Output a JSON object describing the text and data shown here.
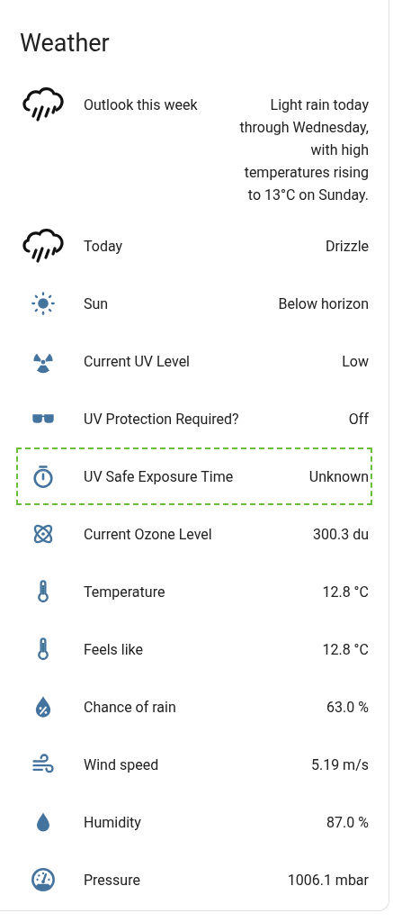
{
  "title": "Weather",
  "rows": [
    {
      "kind": "forecast",
      "label": "Outlook this week",
      "value": "Light rain today through Wednesday, with high temperatures rising to 13°C on Sunday.",
      "highlighted": false
    },
    {
      "kind": "forecast",
      "label": "Today",
      "value": "Drizzle",
      "highlighted": false
    },
    {
      "kind": "sensor",
      "label": "Sun",
      "value": "Below horizon",
      "highlighted": false
    },
    {
      "kind": "sensor",
      "label": "Current UV Level",
      "value": "Low",
      "highlighted": false
    },
    {
      "kind": "sensor",
      "label": "UV Protection Required?",
      "value": "Off",
      "highlighted": false
    },
    {
      "kind": "sensor",
      "label": "UV Safe Exposure Time",
      "value": "Unknown",
      "highlighted": true
    },
    {
      "kind": "sensor",
      "label": "Current Ozone Level",
      "value": "300.3 du",
      "highlighted": false
    },
    {
      "kind": "sensor",
      "label": "Temperature",
      "value": "12.8 °C",
      "highlighted": false
    },
    {
      "kind": "sensor",
      "label": "Feels like",
      "value": "12.8 °C",
      "highlighted": false
    },
    {
      "kind": "sensor",
      "label": "Chance of rain",
      "value": "63.0 %",
      "highlighted": false
    },
    {
      "kind": "sensor",
      "label": "Wind speed",
      "value": "5.19 m/s",
      "highlighted": false
    },
    {
      "kind": "sensor",
      "label": "Humidity",
      "value": "87.0 %",
      "highlighted": false
    },
    {
      "kind": "sensor",
      "label": "Pressure",
      "value": "1006.1 mbar",
      "highlighted": false
    }
  ]
}
